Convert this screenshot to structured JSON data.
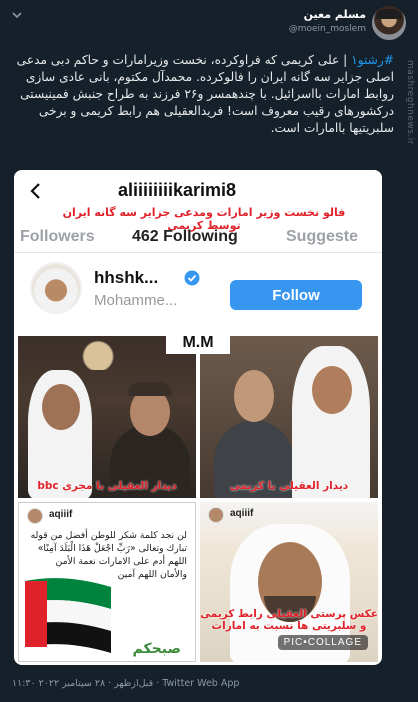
{
  "header": {
    "display_name": "مسلم معین",
    "handle": "@moein_moslem",
    "watermark": "mashreghnews.ir"
  },
  "tweet": {
    "hashtag": "#رشتو۱",
    "text": " | علی کریمی که فراوکرده، نخست وزیرامارات و حاکم دبی مدعی اصلی جزایر سه گانه ایران را فالوکرده. محمدآل مکتوم، بانی عادی سازی روابط امارات بااسرائیل. با چندهمسر و۲۶ فرزند به طراح جنبش فمینیستی درکشورهای رقیب معروف است!  فریدالعقیلی هم رابط کریمی و برخی سلبریتیها باامارات است."
  },
  "media": {
    "ig_username": "aliiiiiiiikarimi8",
    "caption_top": "فالو نخست وزیر امارات ومدعی جزایر سه گانه ایران توسط کریمی",
    "stats": {
      "followers": "Followers",
      "following": "462 Following",
      "suggested": "Suggeste"
    },
    "account_name": "hhshk...",
    "account_sub": "Mohamme...",
    "follow_label": "Follow",
    "center_label": "M.M",
    "photo1_caption": "دیدار العقیلی با مجری bbc",
    "photo2_caption": "دیدار العقیلی با کریمی",
    "photo3_handle": "aqiiif",
    "photo3_text": "لن نجد كلمة شكر للوطن أفضل من قوله تبارك وتعالى «رَبِّ اجْعَلْ هَذَا الْبَلَدَ آمِنًا» اللهم أدم على الامارات نعمة الأمن والأمان اللهم آمين",
    "photo3_bottom": "صبحكم",
    "photo4_handle": "aqiiif",
    "photo4_caption": "عکس پرستی العقیلی رابط کریمی و سلبریتی ها نسبت به امارات",
    "pic_collage": "PIC•COLLAGE"
  },
  "footer": {
    "meta": "۱۱:۳۰ قبل‌ازظهر · ۲۸ سپتامبر ۲۰۲۲ · Twitter Web App"
  },
  "colors": {
    "background": "#15202b",
    "hashtag": "#1d9bf0",
    "follow_button": "#3797f0",
    "caption_red": "#e0232b"
  }
}
